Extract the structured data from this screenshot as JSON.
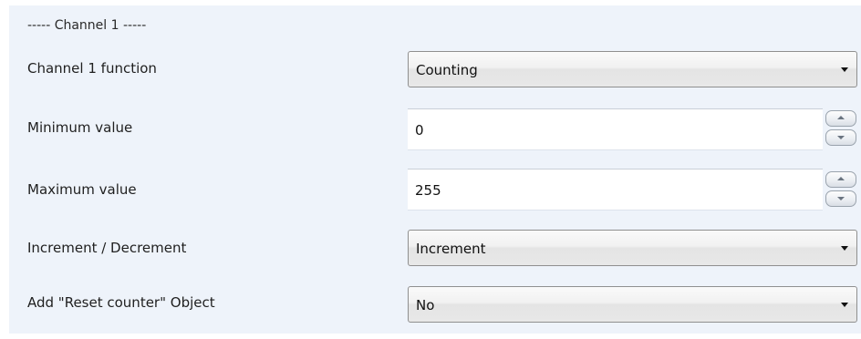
{
  "section": {
    "title": "----- Channel 1 -----"
  },
  "rows": {
    "channel_function": {
      "label": "Channel 1 function",
      "value": "Counting"
    },
    "minimum_value": {
      "label": "Minimum value",
      "value": "0"
    },
    "maximum_value": {
      "label": "Maximum value",
      "value": "255"
    },
    "increment_decrement": {
      "label": "Increment / Decrement",
      "value": "Increment"
    },
    "reset_counter_object": {
      "label": "Add \"Reset counter\" Object",
      "value": "No"
    }
  },
  "icons": {
    "dropdown_arrow": "chevron-down-icon",
    "spin_up": "triangle-up-icon",
    "spin_down": "triangle-down-icon"
  },
  "colors": {
    "panel_background": "#eef3fa",
    "field_background": "#ffffff",
    "dropdown_border": "#8f8f8f"
  }
}
